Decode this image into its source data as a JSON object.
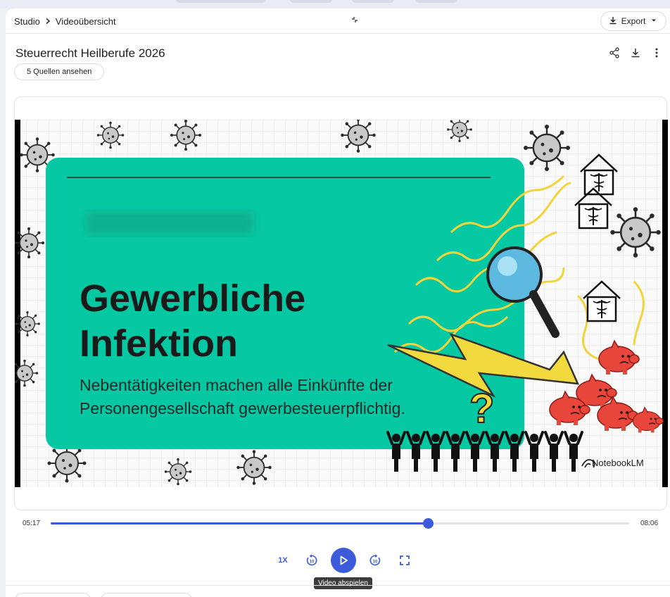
{
  "breadcrumb": {
    "root": "Studio",
    "current": "Videoübersicht"
  },
  "export_label": "Export",
  "notebook_title": "Steuerrecht Heilberufe 2026",
  "sources_label": "5 Quellen ansehen",
  "video": {
    "headline_line1": "Gewerbliche",
    "headline_line2": "Infektion",
    "sub_line1": "Nebentätigkeiten machen alle Einkünfte der",
    "sub_line2": "Personengesellschaft gewerbesteuerpflichtig.",
    "brand": "NotebookLM",
    "question_mark": "?"
  },
  "player": {
    "current_time": "05:17",
    "duration": "08:06",
    "progress": 0.652,
    "speed": "1X",
    "tooltip": "Video abspielen"
  },
  "colors": {
    "accent": "#3b5bdb",
    "slide_green": "#06c9a4"
  },
  "icons": [
    "chevron-right-icon",
    "collapse-icon",
    "download-icon",
    "caret-down-icon",
    "share-icon",
    "more-vert-icon",
    "replay-10-icon",
    "play-icon",
    "forward-10-icon",
    "fullscreen-icon"
  ]
}
